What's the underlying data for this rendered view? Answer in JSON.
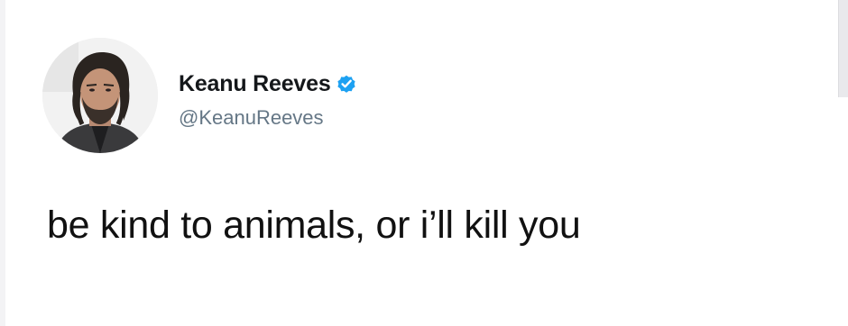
{
  "tweet": {
    "author": {
      "display_name": "Keanu Reeves",
      "handle": "@KeanuReeves",
      "verified": true,
      "avatar_icon": "profile-photo"
    },
    "text": "be kind to animals, or i’ll kill you"
  },
  "colors": {
    "verified_blue": "#1da1f2",
    "handle_gray": "#657786",
    "text": "#111111",
    "background": "#ffffff"
  }
}
